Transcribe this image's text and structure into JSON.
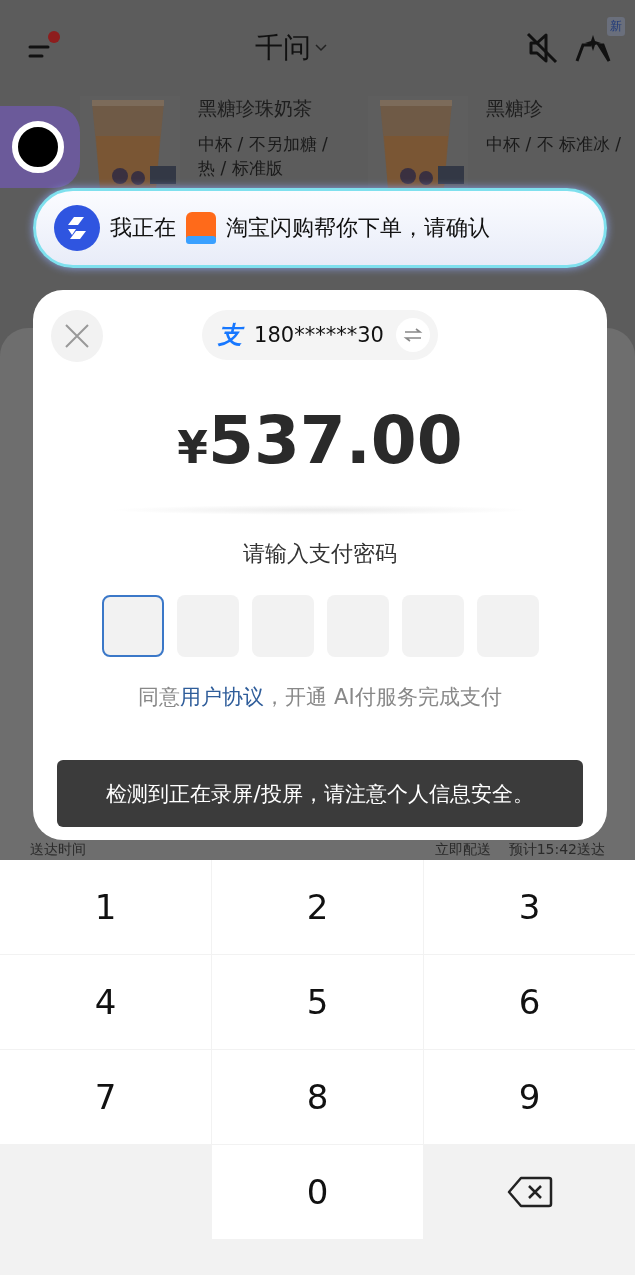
{
  "top_bar": {
    "title": "千问",
    "menu_notification": true,
    "new_badge": "新"
  },
  "products": [
    {
      "title": "黑糖珍珠奶茶",
      "spec": "中杯 / 不另加糖 / 热 / 标准版"
    },
    {
      "title": "黑糖珍",
      "spec": "中杯 / 不 标准冰 /"
    }
  ],
  "banner": {
    "before": "我正在",
    "after": "淘宝闪购帮你下单，请确认"
  },
  "payment": {
    "logo": "支",
    "account": "180******30",
    "currency": "¥",
    "amount": "537.00",
    "prompt": "请输入支付密码",
    "pin_boxes": [
      {
        "selected": true
      },
      {
        "selected": false
      },
      {
        "selected": false
      },
      {
        "selected": false
      },
      {
        "selected": false
      },
      {
        "selected": false
      }
    ],
    "agreement": {
      "before": "同意",
      "link": "用户协议",
      "after": "，开通 AI付服务完成支付"
    }
  },
  "toast": "检测到正在录屏/投屏，请注意个人信息安全。",
  "delivery": {
    "label": "送达时间",
    "mode": "立即配送",
    "eta": "预计15:42送达"
  },
  "keypad": [
    {
      "kind": "digit",
      "label": "1"
    },
    {
      "kind": "digit",
      "label": "2"
    },
    {
      "kind": "digit",
      "label": "3"
    },
    {
      "kind": "digit",
      "label": "4"
    },
    {
      "kind": "digit",
      "label": "5"
    },
    {
      "kind": "digit",
      "label": "6"
    },
    {
      "kind": "digit",
      "label": "7"
    },
    {
      "kind": "digit",
      "label": "8"
    },
    {
      "kind": "digit",
      "label": "9"
    },
    {
      "kind": "blank"
    },
    {
      "kind": "digit",
      "label": "0"
    },
    {
      "kind": "backspace"
    }
  ]
}
